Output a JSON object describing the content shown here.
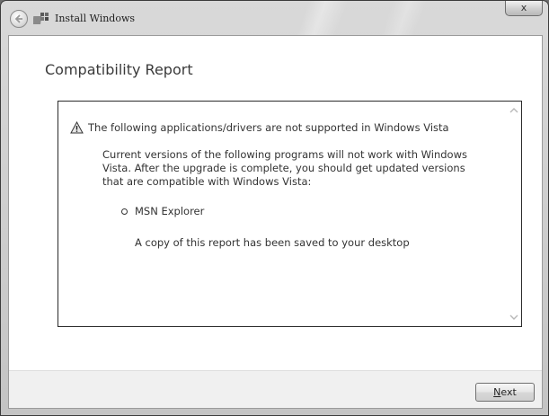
{
  "window": {
    "title": "Install Windows",
    "close_label": "x"
  },
  "page": {
    "title": "Compatibility Report"
  },
  "report": {
    "warning": "The following applications/drivers are not supported in Windows Vista",
    "paragraph": "Current versions of the following programs will not work with Windows Vista. After the upgrade is complete, you should get updated versions that are compatible with Windows Vista:",
    "items": [
      "MSN Explorer"
    ],
    "saved_note": "A copy of this report has been saved to your desktop"
  },
  "footer": {
    "next_mnemonic": "N",
    "next_rest": "ext"
  },
  "icons": {
    "back": "back-arrow-icon",
    "app": "windows-setup-icon",
    "warning": "warning-icon",
    "scroll_up": "scroll-up-arrow-icon",
    "scroll_down": "scroll-down-arrow-icon"
  }
}
